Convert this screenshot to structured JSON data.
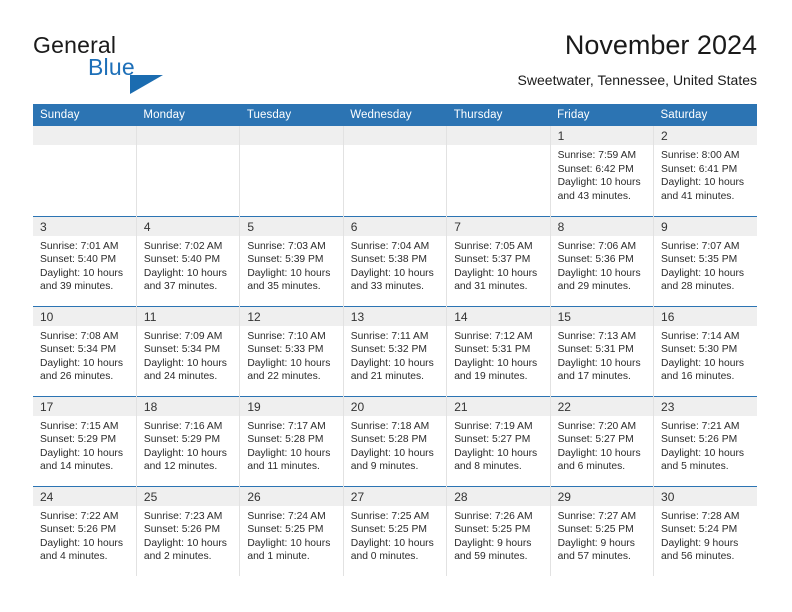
{
  "brand": {
    "word_general": "General",
    "word_blue": "Blue"
  },
  "header": {
    "title": "November 2024",
    "subtitle": "Sweetwater, Tennessee, United States"
  },
  "colors": {
    "header_blue": "#2c74b3",
    "brand_blue": "#1d6fb8",
    "daybar_gray": "#efefef"
  },
  "weekday_headers": [
    "Sunday",
    "Monday",
    "Tuesday",
    "Wednesday",
    "Thursday",
    "Friday",
    "Saturday"
  ],
  "weeks": [
    [
      {
        "day": "",
        "lines": []
      },
      {
        "day": "",
        "lines": []
      },
      {
        "day": "",
        "lines": []
      },
      {
        "day": "",
        "lines": []
      },
      {
        "day": "",
        "lines": []
      },
      {
        "day": "1",
        "lines": [
          "Sunrise: 7:59 AM",
          "Sunset: 6:42 PM",
          "Daylight: 10 hours",
          "and 43 minutes."
        ]
      },
      {
        "day": "2",
        "lines": [
          "Sunrise: 8:00 AM",
          "Sunset: 6:41 PM",
          "Daylight: 10 hours",
          "and 41 minutes."
        ]
      }
    ],
    [
      {
        "day": "3",
        "lines": [
          "Sunrise: 7:01 AM",
          "Sunset: 5:40 PM",
          "Daylight: 10 hours",
          "and 39 minutes."
        ]
      },
      {
        "day": "4",
        "lines": [
          "Sunrise: 7:02 AM",
          "Sunset: 5:40 PM",
          "Daylight: 10 hours",
          "and 37 minutes."
        ]
      },
      {
        "day": "5",
        "lines": [
          "Sunrise: 7:03 AM",
          "Sunset: 5:39 PM",
          "Daylight: 10 hours",
          "and 35 minutes."
        ]
      },
      {
        "day": "6",
        "lines": [
          "Sunrise: 7:04 AM",
          "Sunset: 5:38 PM",
          "Daylight: 10 hours",
          "and 33 minutes."
        ]
      },
      {
        "day": "7",
        "lines": [
          "Sunrise: 7:05 AM",
          "Sunset: 5:37 PM",
          "Daylight: 10 hours",
          "and 31 minutes."
        ]
      },
      {
        "day": "8",
        "lines": [
          "Sunrise: 7:06 AM",
          "Sunset: 5:36 PM",
          "Daylight: 10 hours",
          "and 29 minutes."
        ]
      },
      {
        "day": "9",
        "lines": [
          "Sunrise: 7:07 AM",
          "Sunset: 5:35 PM",
          "Daylight: 10 hours",
          "and 28 minutes."
        ]
      }
    ],
    [
      {
        "day": "10",
        "lines": [
          "Sunrise: 7:08 AM",
          "Sunset: 5:34 PM",
          "Daylight: 10 hours",
          "and 26 minutes."
        ]
      },
      {
        "day": "11",
        "lines": [
          "Sunrise: 7:09 AM",
          "Sunset: 5:34 PM",
          "Daylight: 10 hours",
          "and 24 minutes."
        ]
      },
      {
        "day": "12",
        "lines": [
          "Sunrise: 7:10 AM",
          "Sunset: 5:33 PM",
          "Daylight: 10 hours",
          "and 22 minutes."
        ]
      },
      {
        "day": "13",
        "lines": [
          "Sunrise: 7:11 AM",
          "Sunset: 5:32 PM",
          "Daylight: 10 hours",
          "and 21 minutes."
        ]
      },
      {
        "day": "14",
        "lines": [
          "Sunrise: 7:12 AM",
          "Sunset: 5:31 PM",
          "Daylight: 10 hours",
          "and 19 minutes."
        ]
      },
      {
        "day": "15",
        "lines": [
          "Sunrise: 7:13 AM",
          "Sunset: 5:31 PM",
          "Daylight: 10 hours",
          "and 17 minutes."
        ]
      },
      {
        "day": "16",
        "lines": [
          "Sunrise: 7:14 AM",
          "Sunset: 5:30 PM",
          "Daylight: 10 hours",
          "and 16 minutes."
        ]
      }
    ],
    [
      {
        "day": "17",
        "lines": [
          "Sunrise: 7:15 AM",
          "Sunset: 5:29 PM",
          "Daylight: 10 hours",
          "and 14 minutes."
        ]
      },
      {
        "day": "18",
        "lines": [
          "Sunrise: 7:16 AM",
          "Sunset: 5:29 PM",
          "Daylight: 10 hours",
          "and 12 minutes."
        ]
      },
      {
        "day": "19",
        "lines": [
          "Sunrise: 7:17 AM",
          "Sunset: 5:28 PM",
          "Daylight: 10 hours",
          "and 11 minutes."
        ]
      },
      {
        "day": "20",
        "lines": [
          "Sunrise: 7:18 AM",
          "Sunset: 5:28 PM",
          "Daylight: 10 hours",
          "and 9 minutes."
        ]
      },
      {
        "day": "21",
        "lines": [
          "Sunrise: 7:19 AM",
          "Sunset: 5:27 PM",
          "Daylight: 10 hours",
          "and 8 minutes."
        ]
      },
      {
        "day": "22",
        "lines": [
          "Sunrise: 7:20 AM",
          "Sunset: 5:27 PM",
          "Daylight: 10 hours",
          "and 6 minutes."
        ]
      },
      {
        "day": "23",
        "lines": [
          "Sunrise: 7:21 AM",
          "Sunset: 5:26 PM",
          "Daylight: 10 hours",
          "and 5 minutes."
        ]
      }
    ],
    [
      {
        "day": "24",
        "lines": [
          "Sunrise: 7:22 AM",
          "Sunset: 5:26 PM",
          "Daylight: 10 hours",
          "and 4 minutes."
        ]
      },
      {
        "day": "25",
        "lines": [
          "Sunrise: 7:23 AM",
          "Sunset: 5:26 PM",
          "Daylight: 10 hours",
          "and 2 minutes."
        ]
      },
      {
        "day": "26",
        "lines": [
          "Sunrise: 7:24 AM",
          "Sunset: 5:25 PM",
          "Daylight: 10 hours",
          "and 1 minute."
        ]
      },
      {
        "day": "27",
        "lines": [
          "Sunrise: 7:25 AM",
          "Sunset: 5:25 PM",
          "Daylight: 10 hours",
          "and 0 minutes."
        ]
      },
      {
        "day": "28",
        "lines": [
          "Sunrise: 7:26 AM",
          "Sunset: 5:25 PM",
          "Daylight: 9 hours",
          "and 59 minutes."
        ]
      },
      {
        "day": "29",
        "lines": [
          "Sunrise: 7:27 AM",
          "Sunset: 5:25 PM",
          "Daylight: 9 hours",
          "and 57 minutes."
        ]
      },
      {
        "day": "30",
        "lines": [
          "Sunrise: 7:28 AM",
          "Sunset: 5:24 PM",
          "Daylight: 9 hours",
          "and 56 minutes."
        ]
      }
    ]
  ]
}
